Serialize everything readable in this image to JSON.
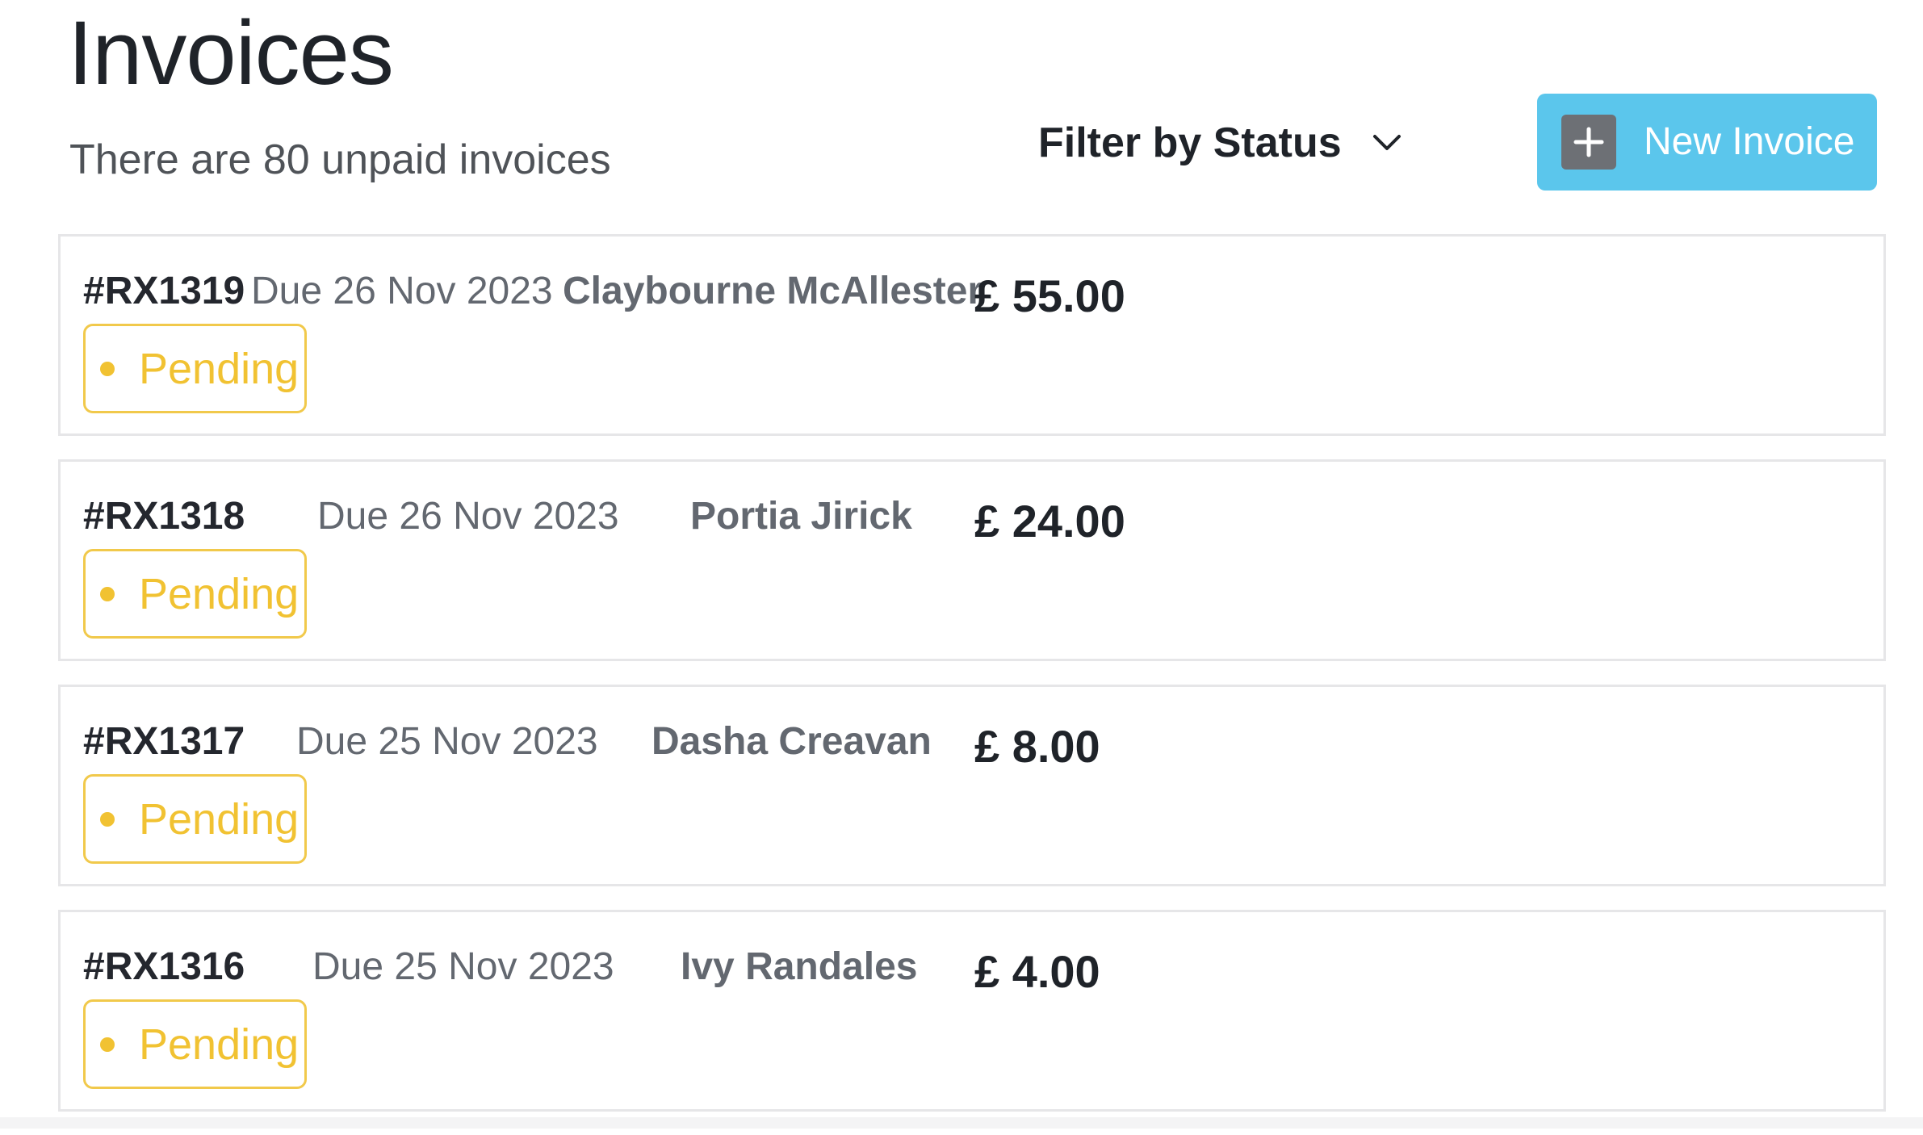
{
  "header": {
    "title": "Invoices",
    "subtitle": "There are 80 unpaid invoices",
    "filter_label": "Filter by Status",
    "new_invoice_label": "New Invoice"
  },
  "colors": {
    "accent": "#5bc6ec",
    "pending": "#f1c232",
    "border": "#e6e6e8"
  },
  "icons": {
    "filter": "chevron-down-icon",
    "new_invoice": "plus-icon",
    "status": "status-dot-icon"
  },
  "invoices": [
    {
      "id": "#RX1319",
      "due": "Due 26 Nov 2023",
      "client": "Claybourne McAllester",
      "amount": "£ 55.00",
      "status": "Pending"
    },
    {
      "id": "#RX1318",
      "due": "Due 26 Nov 2023",
      "client": "Portia Jirick",
      "amount": "£ 24.00",
      "status": "Pending"
    },
    {
      "id": "#RX1317",
      "due": "Due 25 Nov 2023",
      "client": "Dasha Creavan",
      "amount": "£ 8.00",
      "status": "Pending"
    },
    {
      "id": "#RX1316",
      "due": "Due 25 Nov 2023",
      "client": "Ivy Randales",
      "amount": "£ 4.00",
      "status": "Pending"
    }
  ]
}
